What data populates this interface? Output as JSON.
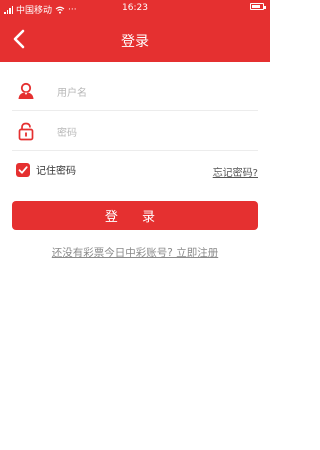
{
  "status_bar": {
    "carrier": "中国移动",
    "dots": "···",
    "time": "16:23"
  },
  "header": {
    "title": "登录",
    "back_icon": "chevron-left-icon"
  },
  "form": {
    "username_placeholder": "用户名",
    "password_placeholder": "密码",
    "remember_label": "记住密码",
    "remember_checked": true,
    "forgot_link": "忘记密码?",
    "login_button": "登 录",
    "register_link": "还没有彩票今日中彩账号? 立即注册"
  },
  "colors": {
    "brand": "#e53030"
  }
}
